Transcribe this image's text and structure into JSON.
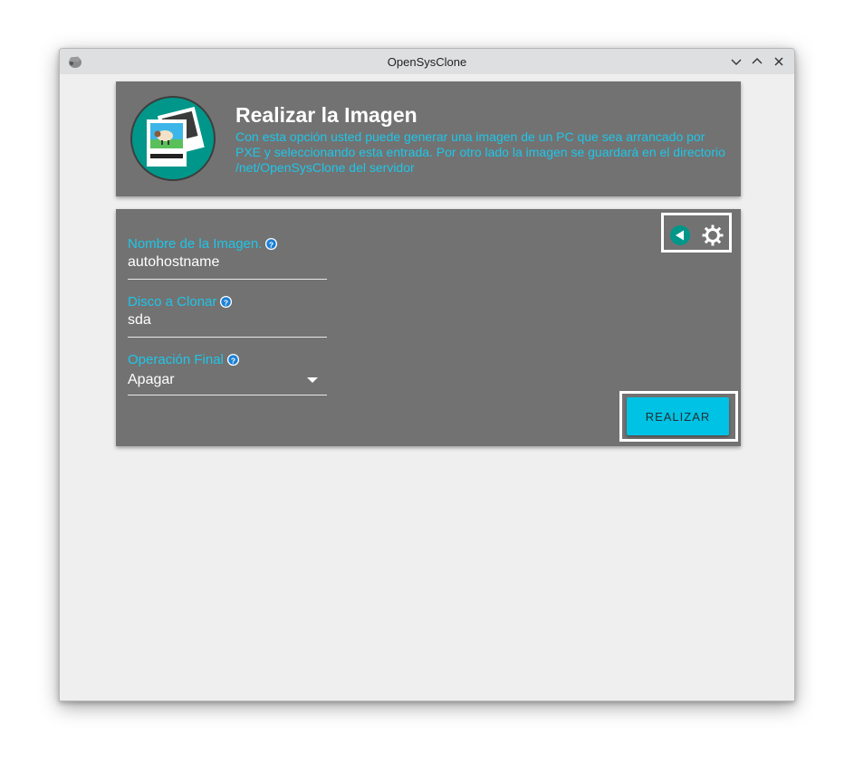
{
  "window": {
    "title": "OpenSysClone"
  },
  "header": {
    "title": "Realizar la Imagen",
    "description": "Con esta opción usted puede generar una imagen de un PC que sea arrancado por PXE y seleccionando esta entrada. Por otro lado la imagen se guardará en el directorio /net/OpenSysClone del servidor",
    "icon": "image-gallery-icon"
  },
  "form": {
    "image_name": {
      "label": "Nombre de la Imagen.",
      "value": "autohostname"
    },
    "disk": {
      "label": "Disco a Clonar",
      "value": "sda"
    },
    "final_operation": {
      "label": "Operación Final",
      "selected": "Apagar"
    }
  },
  "actions": {
    "submit_label": "REALIZAR"
  },
  "colors": {
    "accent": "#1ec6e8",
    "button": "#00c2e4",
    "card": "#727272",
    "teal": "#00968a"
  }
}
